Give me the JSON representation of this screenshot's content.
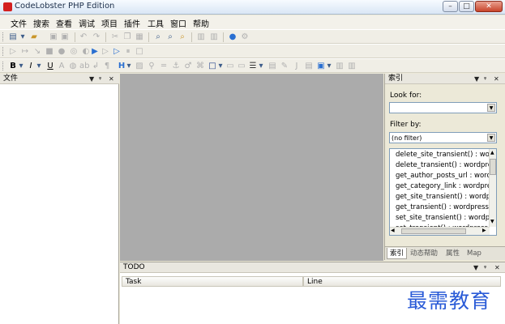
{
  "window": {
    "title": "CodeLobster PHP Edition"
  },
  "menu": [
    "文件",
    "搜索",
    "查看",
    "调试",
    "项目",
    "插件",
    "工具",
    "窗口",
    "帮助"
  ],
  "left_panel": {
    "title": "文件"
  },
  "right_panel": {
    "title": "索引",
    "look_for_label": "Look for:",
    "look_for_value": "",
    "filter_label": "Filter by:",
    "filter_value": "(no filter)",
    "items": [
      "delete_site_transient() : wordpress",
      "delete_transient() : wordpress",
      "get_author_posts_url : wordpress",
      "get_category_link : wordpress",
      "get_site_transient() : wordpress",
      "get_transient() : wordpress",
      "set_site_transient() : wordpress",
      "set_transient() : wordpress"
    ],
    "tabs": [
      "索引",
      "动态帮助",
      "属性",
      "Map"
    ]
  },
  "todo_panel": {
    "title": "TODO",
    "columns": [
      "Task",
      "Line"
    ]
  },
  "watermark": "最需教育"
}
